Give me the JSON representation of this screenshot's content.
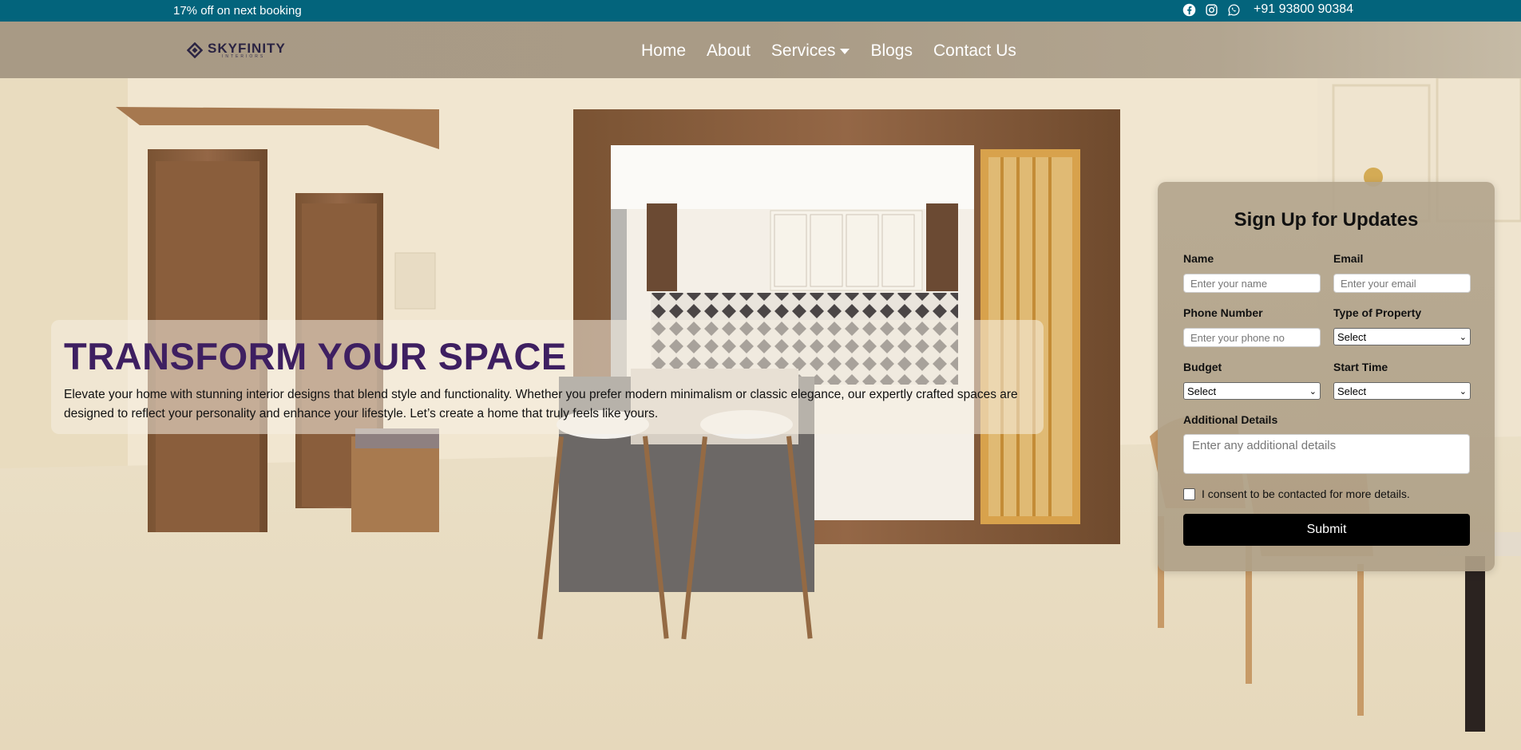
{
  "topbar": {
    "offer": "17% off on next booking",
    "icons": [
      "facebook-icon",
      "instagram-icon",
      "whatsapp-icon"
    ],
    "phone": "+91 93800 90384",
    "bg_color": "#03647c"
  },
  "nav": {
    "logo_name": "SKYFINITY",
    "logo_sub": "INTERIORS",
    "items": [
      {
        "label": "Home"
      },
      {
        "label": "About"
      },
      {
        "label": "Services"
      },
      {
        "label": "Blogs"
      },
      {
        "label": "Contact Us"
      }
    ]
  },
  "hero": {
    "title": "TRANSFORM YOUR SPACE",
    "description": "Elevate your home with stunning interior designs that blend style and functionality. Whether you prefer modern minimalism or classic elegance, our expertly crafted spaces are designed to reflect your personality and enhance your lifestyle. Let’s create a home that truly feels like yours.",
    "title_color": "#3e1f61"
  },
  "form": {
    "title": "Sign Up for Updates",
    "name_label": "Name",
    "name_placeholder": "Enter your name",
    "email_label": "Email",
    "email_placeholder": "Enter your email",
    "phone_label": "Phone Number",
    "phone_placeholder": "Enter your phone no",
    "property_label": "Type of Property",
    "property_value": "Select",
    "budget_label": "Budget",
    "budget_value": "Select",
    "start_label": "Start Time",
    "start_value": "Select",
    "details_label": "Additional Details",
    "details_placeholder": "Enter any additional details",
    "consent_label": "I consent to be contacted for more details.",
    "submit_label": "Submit"
  }
}
